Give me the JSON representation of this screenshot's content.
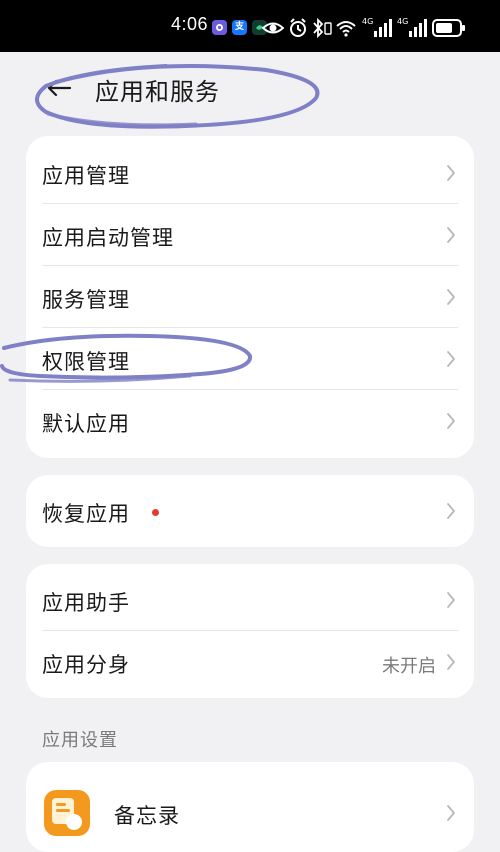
{
  "status_bar": {
    "time": "4:06",
    "notification_icons": [
      "camera-app-icon",
      "alipay-icon",
      "shazam-icon"
    ],
    "alipay_glyph": "支",
    "right_icons": [
      "eye-icon",
      "alarm-icon",
      "bluetooth-icon",
      "wifi-icon",
      "signal-4g-icon",
      "signal-4g-icon",
      "battery-icon"
    ],
    "signal_label_1": "4G",
    "signal_label_2": "4G"
  },
  "header": {
    "title": "应用和服务",
    "back_icon": "back-arrow-icon"
  },
  "group1": {
    "items": [
      {
        "label": "应用管理"
      },
      {
        "label": "应用启动管理"
      },
      {
        "label": "服务管理"
      },
      {
        "label": "权限管理"
      },
      {
        "label": "默认应用"
      }
    ]
  },
  "group2": {
    "items": [
      {
        "label": "恢复应用",
        "badge": "red-dot"
      }
    ]
  },
  "group3": {
    "items": [
      {
        "label": "应用助手"
      },
      {
        "label": "应用分身",
        "value": "未开启"
      }
    ]
  },
  "app_settings": {
    "section_label": "应用设置",
    "items": [
      {
        "label": "备忘录",
        "icon": "memo-app-icon"
      }
    ]
  },
  "colors": {
    "background": "#f1f1f3",
    "card": "#ffffff",
    "badge_red": "#e53a2f",
    "annotation_stroke": "#7f80c6",
    "memo_orange": "#f39a1e"
  }
}
